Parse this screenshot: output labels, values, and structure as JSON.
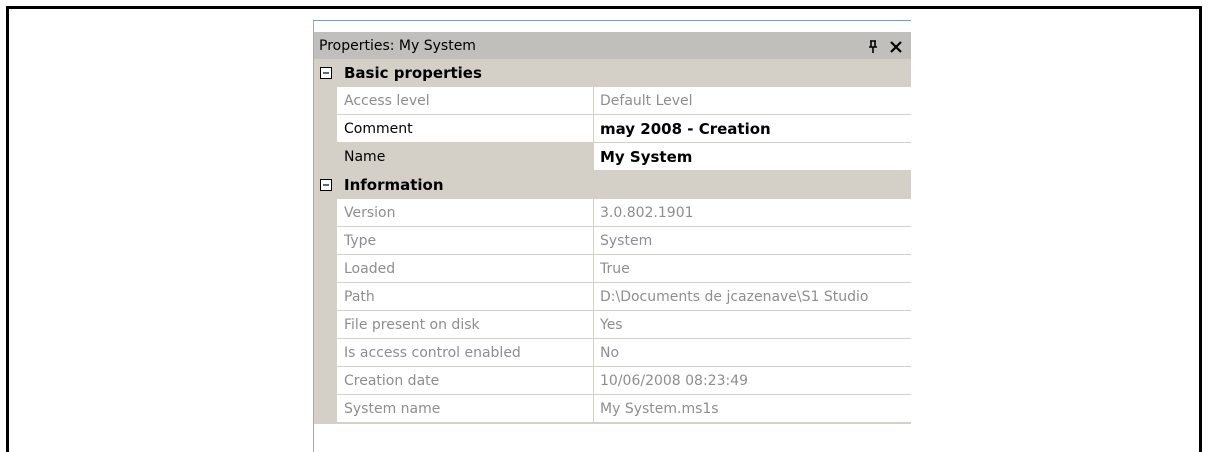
{
  "panel": {
    "title": "Properties: My System",
    "pin_icon": "pin-icon",
    "close_icon": "close-icon"
  },
  "categories": [
    {
      "label": "Basic properties",
      "toggle_icon": "collapse-minus-icon",
      "rows": [
        {
          "name": "Access level",
          "value": "Default Level"
        },
        {
          "name": "Comment",
          "value": "may 2008 - Creation"
        },
        {
          "name": "Name",
          "value": "My System"
        }
      ]
    },
    {
      "label": "Information",
      "toggle_icon": "collapse-minus-icon",
      "rows": [
        {
          "name": "Version",
          "value": "3.0.802.1901"
        },
        {
          "name": "Type",
          "value": "System"
        },
        {
          "name": "Loaded",
          "value": "True"
        },
        {
          "name": "Path",
          "value": "D:\\Documents de jcazenave\\S1 Studio"
        },
        {
          "name": "File present on disk",
          "value": "Yes"
        },
        {
          "name": "Is access control enabled",
          "value": "No"
        },
        {
          "name": "Creation date",
          "value": "10/06/2008 08:23:49"
        },
        {
          "name": "System name",
          "value": "My System.ms1s"
        }
      ]
    }
  ],
  "colors": {
    "category_background": "#d4d0c8",
    "titlebar_background": "#c0bfbb",
    "readonly_text": "#8e8e8e",
    "editable_text": "#000000"
  }
}
